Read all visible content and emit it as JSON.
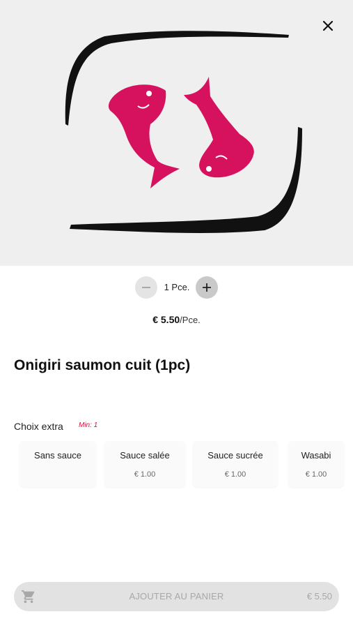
{
  "hero": {
    "image_icon": "sushi-fish-logo-icon",
    "close_icon": "close-icon"
  },
  "quantity": {
    "label": "1 Pce.",
    "minus_icon": "minus-icon",
    "plus_icon": "plus-icon"
  },
  "price": {
    "amount": "€ 5.50",
    "unit": "/Pce."
  },
  "product": {
    "title": "Onigiri saumon cuit (1pc)"
  },
  "extras": {
    "label": "Choix extra",
    "min_badge": "Min: 1",
    "options": [
      {
        "name": "Sans sauce",
        "price": ""
      },
      {
        "name": "Sauce salée",
        "price": "€ 1.00"
      },
      {
        "name": "Sauce sucrée",
        "price": "€ 1.00"
      },
      {
        "name": "Wasabi",
        "price": "€ 1.00"
      }
    ]
  },
  "cart_button": {
    "label": "AJOUTER AU PANIER",
    "price": "€ 5.50",
    "icon": "cart-icon"
  },
  "colors": {
    "accent": "#d6125f",
    "badge": "#d6123f",
    "hero_bg": "#efefef",
    "button_bg": "#e2e2e2"
  }
}
